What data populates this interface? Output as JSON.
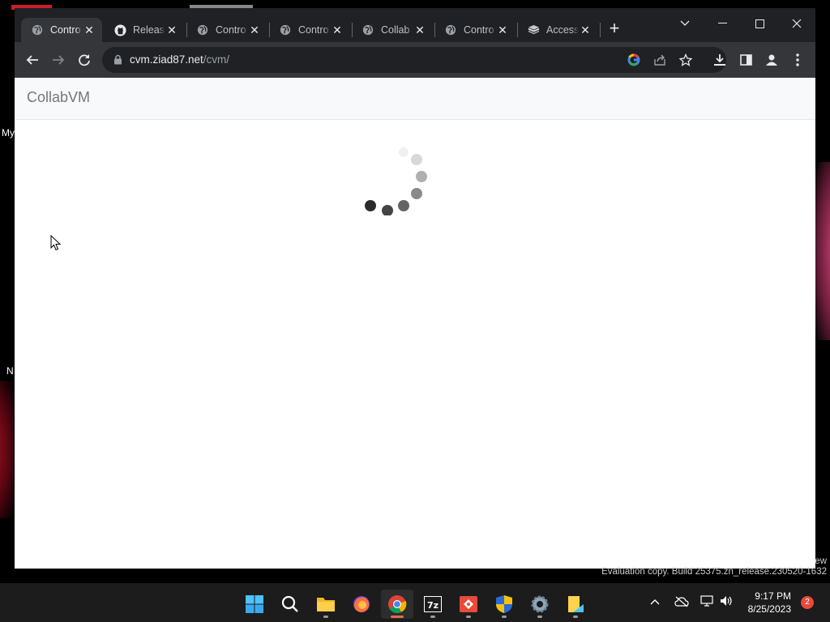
{
  "desktop": {
    "labels": [
      "My",
      "N"
    ]
  },
  "browser": {
    "tabs": [
      {
        "title": "Contro",
        "icon": "globe-icon",
        "active": true
      },
      {
        "title": "Release",
        "icon": "github-icon",
        "active": false
      },
      {
        "title": "Contro",
        "icon": "globe-icon",
        "active": false
      },
      {
        "title": "Contro",
        "icon": "globe-icon",
        "active": false
      },
      {
        "title": "Collab",
        "icon": "globe-icon",
        "active": false
      },
      {
        "title": "Contro",
        "icon": "globe-icon",
        "active": false
      },
      {
        "title": "Access",
        "icon": "stack-icon",
        "active": false
      }
    ],
    "url_host": "cvm.ziad87.net",
    "url_path": "/cvm/"
  },
  "page": {
    "brand": "CollabVM"
  },
  "watermark": {
    "line_top": "ew",
    "line": "Evaluation copy. Build 25375.zn_release.230520-1632"
  },
  "taskbar": {
    "apps": [
      "start-icon",
      "search-icon",
      "file-explorer-icon",
      "firefox-icon",
      "chrome-icon",
      "7zip-icon",
      "git-icon",
      "defender-icon",
      "settings-icon",
      "notepad-icon"
    ],
    "time": "9:17 PM",
    "date": "8/25/2023",
    "notification_count": "2"
  },
  "colors": {
    "accent": "#e8694a",
    "chrome_dark": "#202124",
    "toolbar": "#35363a"
  }
}
